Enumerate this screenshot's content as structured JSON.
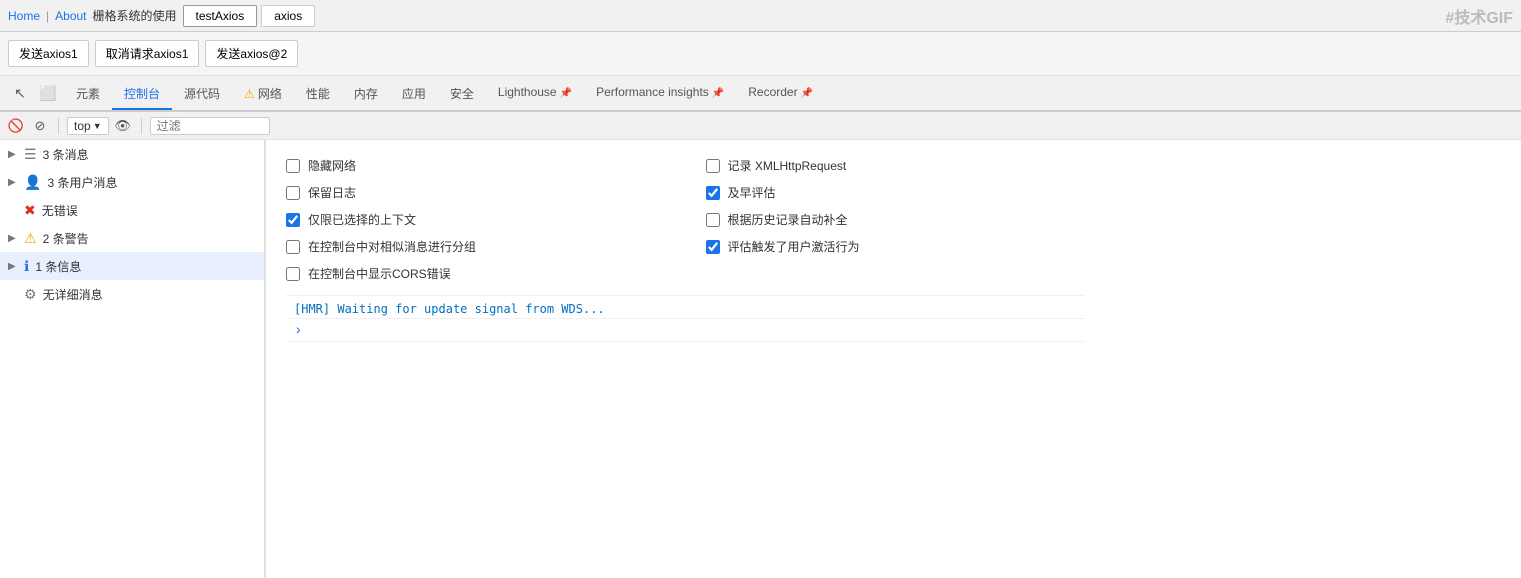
{
  "topbar": {
    "home_link": "Home",
    "sep1": "|",
    "about_link": "About",
    "breadcrumb": "栅格系统的使用",
    "tabs": [
      {
        "label": "testAxios",
        "active": true
      },
      {
        "label": "axios",
        "active": false
      }
    ],
    "logo": "#技术GIF"
  },
  "actionbar": {
    "buttons": [
      {
        "label": "发送axios1"
      },
      {
        "label": "取消请求axios1"
      },
      {
        "label": "发送axios@2"
      }
    ]
  },
  "devtools": {
    "tabs": [
      {
        "label": "元素",
        "active": false,
        "warning": false,
        "pin": false
      },
      {
        "label": "控制台",
        "active": true,
        "warning": false,
        "pin": false
      },
      {
        "label": "源代码",
        "active": false,
        "warning": false,
        "pin": false
      },
      {
        "label": "网络",
        "active": false,
        "warning": true,
        "pin": false
      },
      {
        "label": "性能",
        "active": false,
        "warning": false,
        "pin": false
      },
      {
        "label": "内存",
        "active": false,
        "warning": false,
        "pin": false
      },
      {
        "label": "应用",
        "active": false,
        "warning": false,
        "pin": false
      },
      {
        "label": "安全",
        "active": false,
        "warning": false,
        "pin": false
      },
      {
        "label": "Lighthouse",
        "active": false,
        "warning": false,
        "pin": true
      },
      {
        "label": "Performance insights",
        "active": false,
        "warning": false,
        "pin": true
      },
      {
        "label": "Recorder",
        "active": false,
        "warning": false,
        "pin": true
      }
    ]
  },
  "console_toolbar": {
    "top_label": "top",
    "filter_placeholder": "过滤"
  },
  "sidebar": {
    "items": [
      {
        "expand": "▶",
        "icon_type": "list",
        "icon": "☰",
        "label": "3 条消息",
        "count": "",
        "active": false
      },
      {
        "expand": "▶",
        "icon_type": "user",
        "icon": "👤",
        "label": "3 条用户消息",
        "count": "",
        "active": false
      },
      {
        "expand": "",
        "icon_type": "error",
        "icon": "✖",
        "label": "无错误",
        "count": "",
        "active": false
      },
      {
        "expand": "▶",
        "icon_type": "warning",
        "icon": "⚠",
        "label": "2 条警告",
        "count": "",
        "active": false
      },
      {
        "expand": "▶",
        "icon_type": "info",
        "icon": "ℹ",
        "label": "1 条信息",
        "count": "",
        "active": true
      },
      {
        "expand": "",
        "icon_type": "gear",
        "icon": "⚙",
        "label": "无详细消息",
        "count": "",
        "active": false
      }
    ]
  },
  "settings": {
    "left_column": [
      {
        "label": "隐藏网络",
        "checked": false
      },
      {
        "label": "保留日志",
        "checked": false
      },
      {
        "label": "仅限已选择的上下文",
        "checked": true
      },
      {
        "label": "在控制台中对相似消息进行分组",
        "checked": false
      },
      {
        "label": "在控制台中显示CORS错误",
        "checked": false
      }
    ],
    "right_column": [
      {
        "label": "记录 XMLHttpRequest",
        "checked": false
      },
      {
        "label": "及早评估",
        "checked": true
      },
      {
        "label": "根据历史记录自动补全",
        "checked": false
      },
      {
        "label": "评估触发了用户激活行为",
        "checked": true
      }
    ]
  },
  "console_log": {
    "hmr_message": "[HMR] Waiting for update signal from WDS...",
    "caret": "›"
  }
}
